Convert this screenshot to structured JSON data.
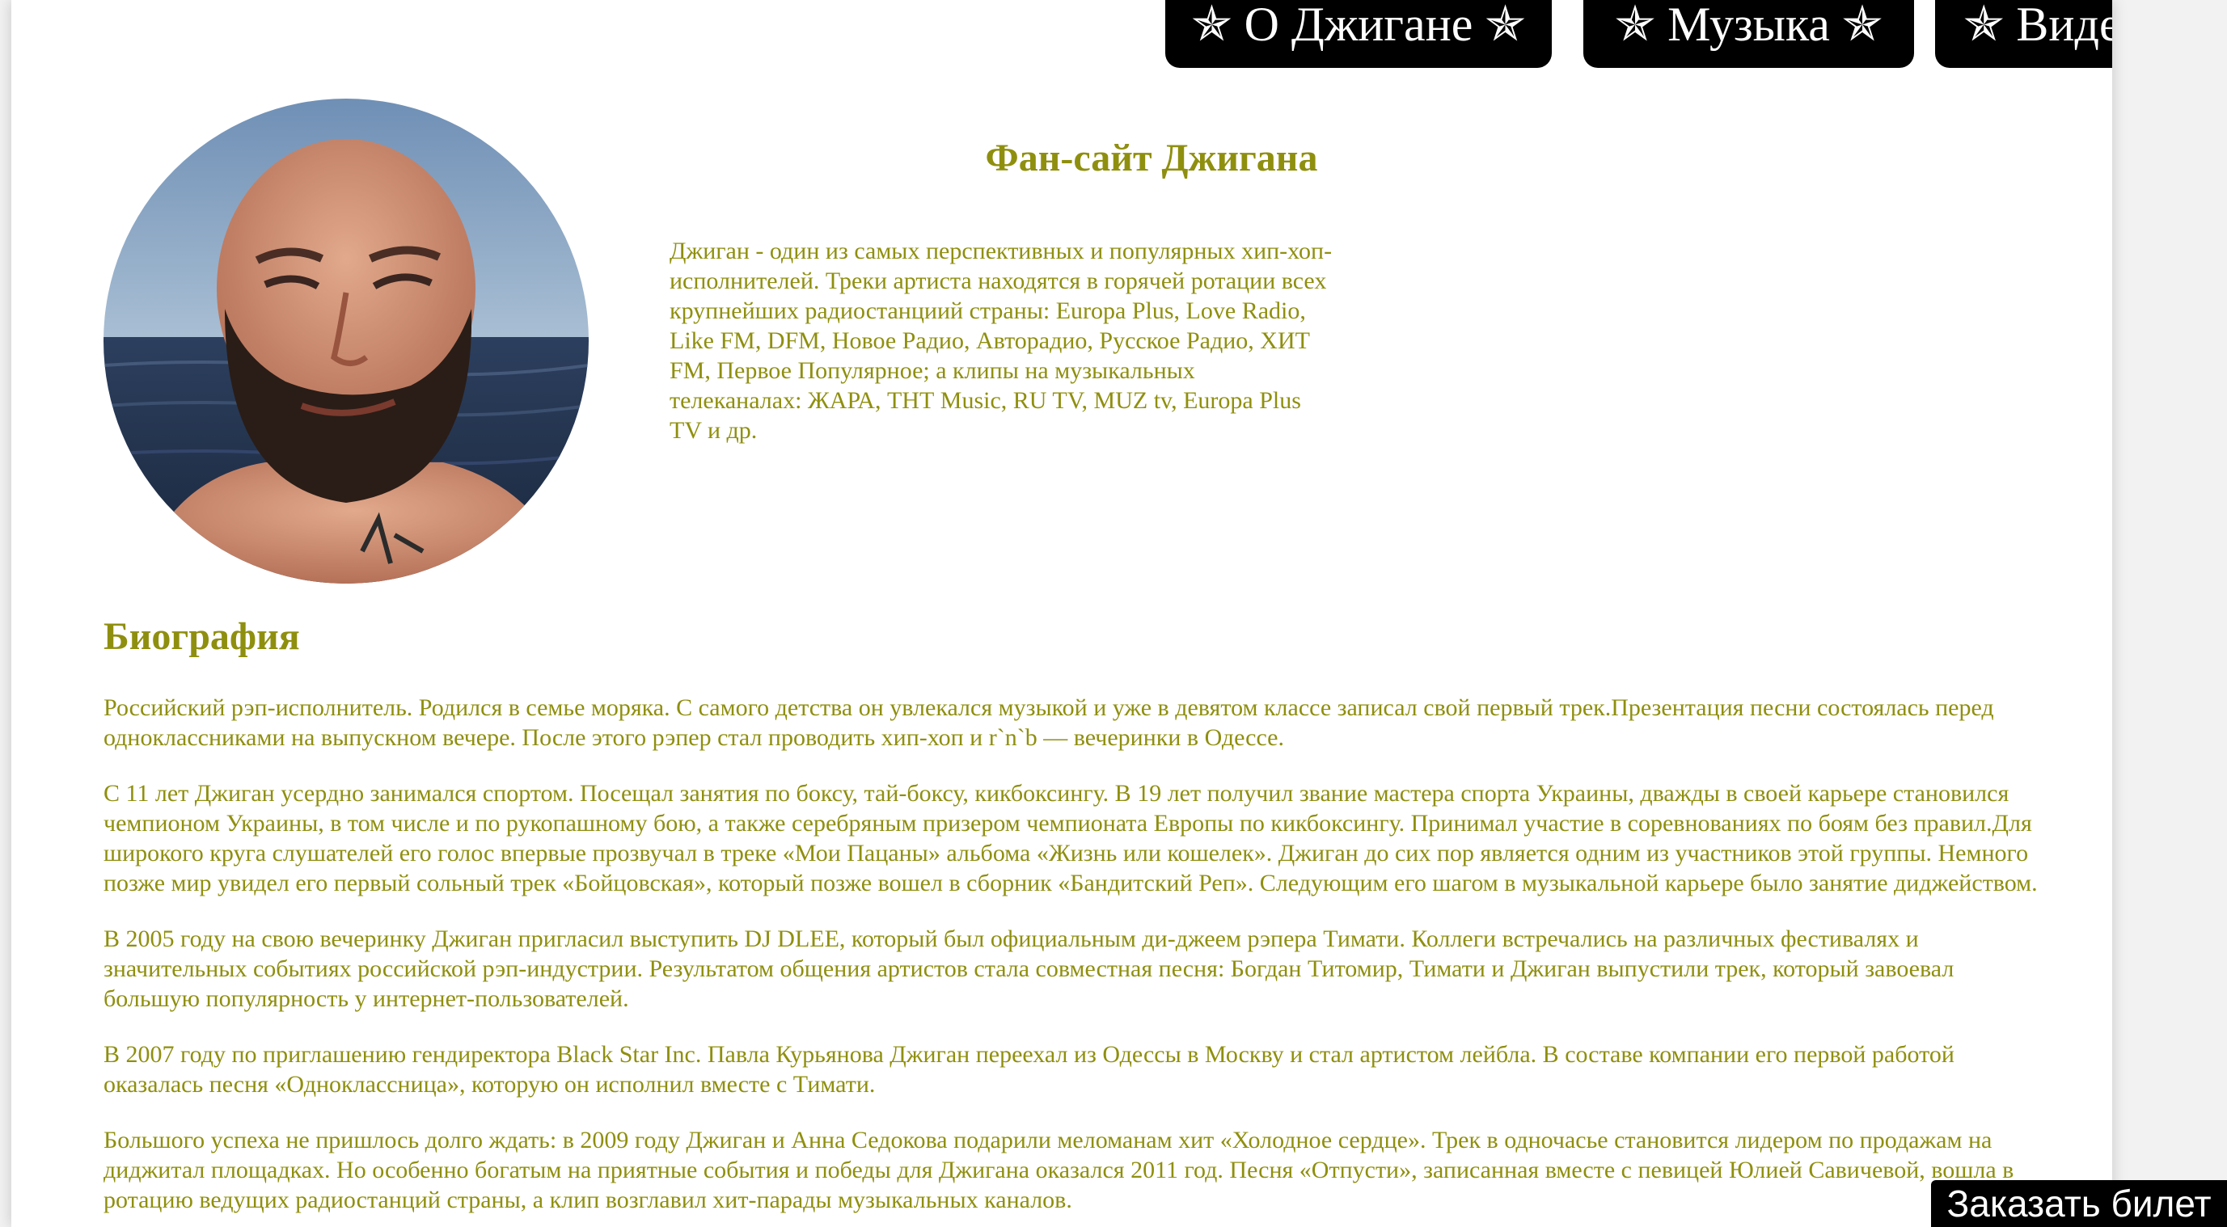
{
  "nav": {
    "items": [
      {
        "label": "✯ О Джигане ✯"
      },
      {
        "label": "✯ Музыка ✯"
      },
      {
        "label": "✯ Видео ✯"
      }
    ]
  },
  "header": {
    "title": "Фан-сайт Джигана",
    "intro": "Джиган - один из самых перспективных и популярных хип-хоп-исполнителей. Треки артиста находятся в горячей ротации всех крупнейших радиостанциий страны: Europa Plus, Love Radio, Like FM, DFM, Новое Радио, Авторадио, Русское Радио, ХИТ FM, Первое Популярное; а клипы на музыкальных телеканалах: ЖАРА, ТНТ Music, RU TV, MUZ tv, Europa Plus TV и др."
  },
  "biography": {
    "title": "Биография",
    "paragraphs": [
      "Российский рэп-исполнитель. Родился в семье моряка. С самого детства он увлекался музыкой и уже в девятом классе записал свой первый трек.Презентация песни состоялась перед одноклассниками на выпускном вечере. После этого рэпер стал проводить хип-хоп и r`n`b — вечеринки в Одессе.",
      "С 11 лет Джиган усердно занимался спортом. Посещал занятия по боксу, тай-боксу, кикбоксингу. В 19 лет получил звание мастера спорта Украины, дважды в своей карьере становился чемпионом Украины, в том числе и по рукопашному бою, а также серебряным призером чемпионата Европы по кикбоксингу. Принимал участие в соревнованиях по боям без правил.Для широкого круга слушателей его голос впервые прозвучал в треке «Мои Пацаны» альбома «Жизнь или кошелек». Джиган до сих пор является одним из участников этой группы. Немного позже мир увидел его первый сольный трек «Бойцовская», который позже вошел в сборник «Бандитский Реп». Следующим его шагом в музыкальной карьере было занятие диджейством.",
      "В 2005 году на свою вечеринку Джиган пригласил выступить DJ DLEE, который был официальным ди-джеем рэпера Тимати. Коллеги встречались на различных фестивалях и значительных событиях российской рэп-индустрии. Результатом общения артистов стала совместная песня: Богдан Титомир, Тимати и Джиган выпустили трек, который завоевал большую популярность у интернет-пользователей.",
      "В 2007 году по приглашению гендиректора Black Star Inc. Павла Курьянова Джиган переехал из Одессы в Москву и стал артистом лейбла. В составе компании его первой работой оказалась песня «Одноклассница», которую он исполнил вместе с Тимати.",
      "Большого успеха не пришлось долго ждать: в 2009 году Джиган и Анна Седокова подарили меломанам хит «Холодное сердце». Трек в одночасье становится лидером по продажам на диджитал площадках. Но особенно богатым на приятные события и победы для Джигана оказался 2011 год. Песня «Отпусти», записанная вместе с певицей Юлией Савичевой, вошла в ротацию ведущих радиостанций страны, а клип возглавил хит-парады музыкальных каналов."
    ]
  },
  "order_button": {
    "label": "Заказать билет"
  },
  "colors": {
    "text": "#8f8f0f",
    "nav_bg": "#000000",
    "nav_text": "#ffffff",
    "page_bg": "#ffffff"
  }
}
